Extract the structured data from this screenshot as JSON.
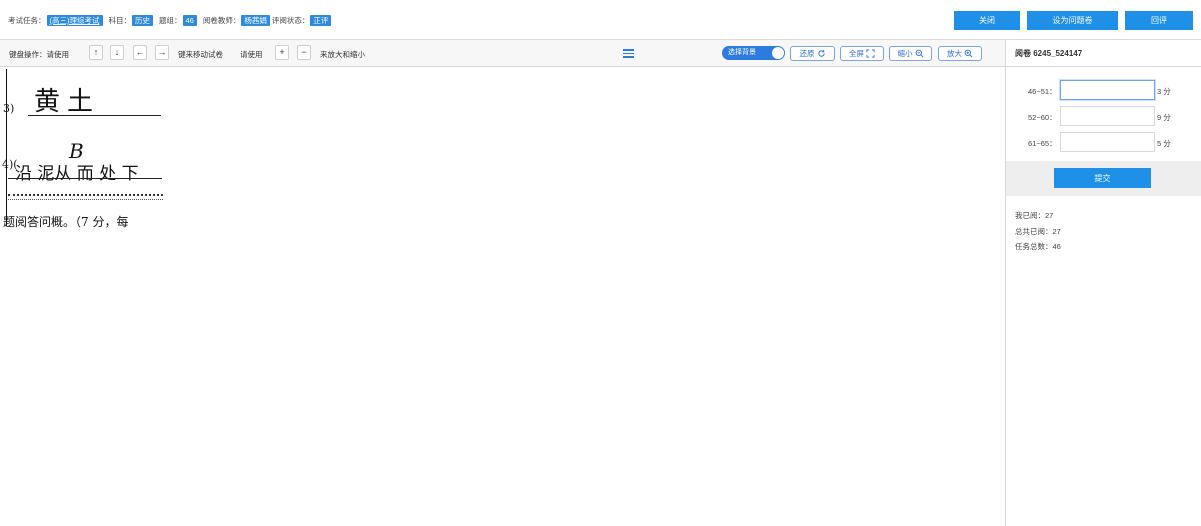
{
  "header": {
    "exam_task_label": "考试任务：",
    "exam_task_value": "(高三)理综考试",
    "subject_label": "科目：",
    "subject_value": "历史",
    "group_label": "题组：",
    "group_value": "46",
    "teacher_label": "阅卷教师：",
    "teacher_value": "杨茜娟",
    "review_status_label": "评阅状态：",
    "review_status_value": "正评",
    "buttons": {
      "close": "关闭",
      "set_problem": "设为问题卷",
      "return_review": "回评"
    }
  },
  "toolbar": {
    "keyboard_prefix": "键盘操作：请使用",
    "arrow_up": "↑",
    "arrow_down": "↓",
    "arrow_left": "←",
    "arrow_right": "→",
    "move_text": "键来移动试卷",
    "please_use": "请使用",
    "plus": "+",
    "minus": "−",
    "zoom_text": "来放大和缩小",
    "select_bg": "选择背景",
    "restore": "还原",
    "fullscreen": "全屏",
    "zoom_out": "缩小",
    "zoom_in": "放大"
  },
  "panel": {
    "title": "阅卷 6245_524147",
    "rows": [
      {
        "label": "46~51：",
        "value": "",
        "unit": "3 分"
      },
      {
        "label": "52~60：",
        "value": "",
        "unit": "9 分"
      },
      {
        "label": "61~65：",
        "value": "",
        "unit": "5 分"
      }
    ],
    "submit": "提交",
    "stats": {
      "my_read": "我已阅：27",
      "total_read": "总共已阅：27",
      "task_total": "任务总数：46"
    }
  },
  "paper": {
    "q3_prefix": "3)",
    "q3_answer": "黄土",
    "q4_prefix": "4)(",
    "q4_letter": "B",
    "q4_answer": "沿 泥从 而 处 下",
    "footer_text": "题阅答问概。（7 分，每"
  },
  "colors": {
    "accent": "#1e90e8",
    "tag": "#2d8ae0",
    "toggle": "#2d7be0"
  }
}
